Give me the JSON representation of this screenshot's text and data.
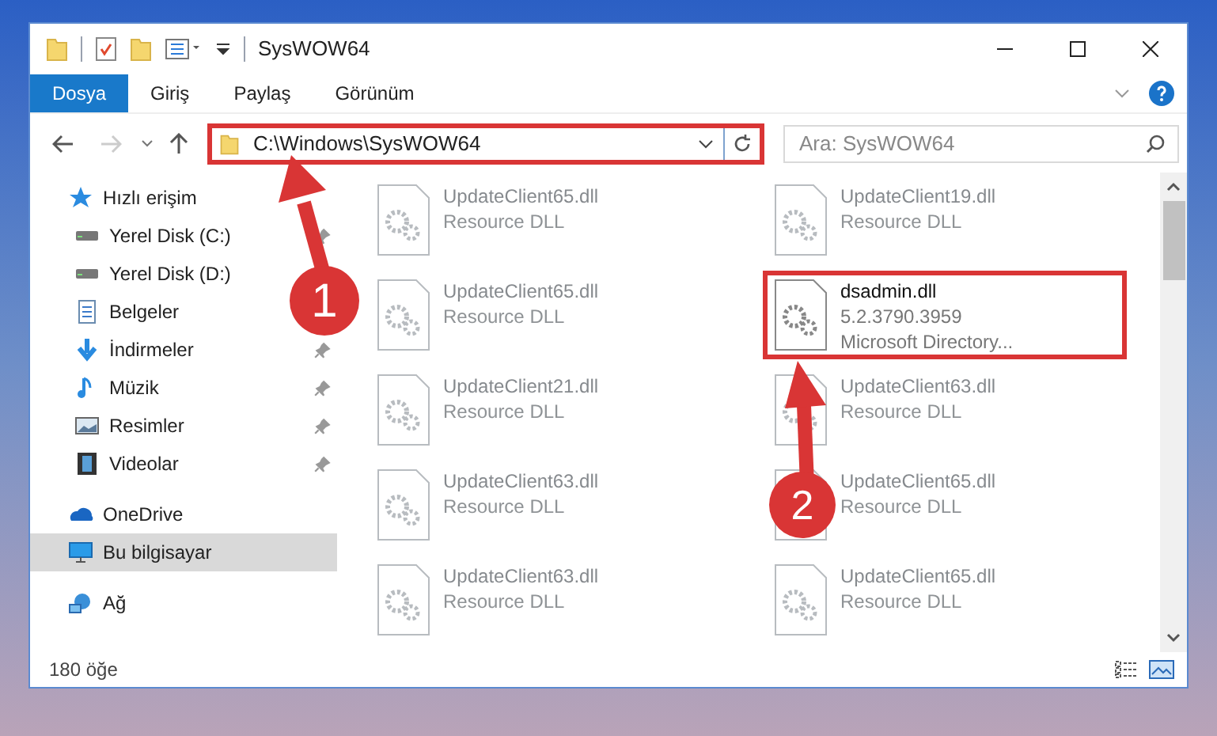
{
  "window": {
    "title": "SysWOW64"
  },
  "ribbon_tabs": [
    {
      "label": "Dosya",
      "selected": true
    },
    {
      "label": "Giriş",
      "selected": false
    },
    {
      "label": "Paylaş",
      "selected": false
    },
    {
      "label": "Görünüm",
      "selected": false
    }
  ],
  "address_bar": {
    "value": "C:\\Windows\\SysWOW64",
    "highlighted": true
  },
  "search": {
    "placeholder": "Ara: SysWOW64"
  },
  "sidebar": {
    "items": [
      {
        "label": "Hızlı erişim",
        "kind": "star",
        "pinned": false,
        "selected": false,
        "children": [
          {
            "label": "Yerel Disk (C:)",
            "kind": "disk",
            "pinned": true,
            "selected": false
          },
          {
            "label": "Yerel Disk (D:)",
            "kind": "disk",
            "pinned": false,
            "selected": false
          },
          {
            "label": "Belgeler",
            "kind": "doc",
            "pinned": false,
            "selected": false
          },
          {
            "label": "İndirmeler",
            "kind": "download",
            "pinned": true,
            "selected": false
          },
          {
            "label": "Müzik",
            "kind": "music",
            "pinned": true,
            "selected": false
          },
          {
            "label": "Resimler",
            "kind": "picture",
            "pinned": true,
            "selected": false
          },
          {
            "label": "Videolar",
            "kind": "video",
            "pinned": true,
            "selected": false
          }
        ]
      },
      {
        "label": "OneDrive",
        "kind": "cloud",
        "pinned": false,
        "selected": false
      },
      {
        "label": "Bu bilgisayar",
        "kind": "computer",
        "pinned": false,
        "selected": true
      },
      {
        "label": "Ağ",
        "kind": "network",
        "pinned": false,
        "selected": false
      }
    ]
  },
  "files": [
    {
      "name": "UpdateClient65.dll",
      "detail_1": "Resource DLL",
      "faded": true,
      "highlighted": false
    },
    {
      "name": "UpdateClient19.dll",
      "detail_1": "Resource DLL",
      "faded": true,
      "highlighted": false
    },
    {
      "name": "UpdateClient65.dll",
      "detail_1": "Resource DLL",
      "faded": true,
      "highlighted": false
    },
    {
      "name": "dsadmin.dll",
      "detail_1": "5.2.3790.3959",
      "detail_2": "Microsoft Directory...",
      "faded": false,
      "highlighted": true
    },
    {
      "name": "UpdateClient21.dll",
      "detail_1": "Resource DLL",
      "faded": true,
      "highlighted": false
    },
    {
      "name": "UpdateClient63.dll",
      "detail_1": "Resource DLL",
      "faded": true,
      "highlighted": false
    },
    {
      "name": "UpdateClient63.dll",
      "detail_1": "Resource DLL",
      "faded": true,
      "highlighted": false
    },
    {
      "name": "UpdateClient65.dll",
      "detail_1": "Resource DLL",
      "faded": true,
      "highlighted": false
    },
    {
      "name": "UpdateClient63.dll",
      "detail_1": "Resource DLL",
      "faded": true,
      "highlighted": false
    },
    {
      "name": "UpdateClient65.dll",
      "detail_1": "Resource DLL",
      "faded": true,
      "highlighted": false
    }
  ],
  "status_bar": {
    "count": "180 öğe"
  },
  "callouts": [
    {
      "number": "1"
    },
    {
      "number": "2"
    }
  ]
}
